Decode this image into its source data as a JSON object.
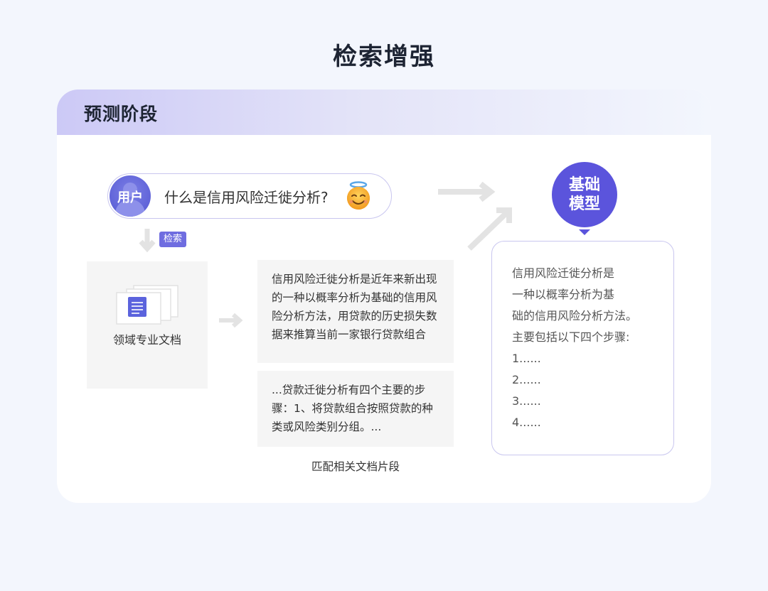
{
  "title": "检索增强",
  "stage": {
    "title": "预测阶段"
  },
  "query": {
    "avatar_label": "用户",
    "text": "什么是信用风险迁徙分析?"
  },
  "search_badge": "检索",
  "doc": {
    "label": "领域专业文档"
  },
  "snippets": [
    "信用风险迁徙分析是近年来新出现的一种以概率分析为基础的信用风险分析方法，用贷款的历史损失数据来推算当前一家银行贷款组合",
    "...贷款迁徙分析有四个主要的步骤：1、将贷款组合按照贷款的种类或风险类别分组。..."
  ],
  "snippet_caption": "匹配相关文档片段",
  "model": {
    "line1": "基础",
    "line2": "模型"
  },
  "answer": {
    "lines": [
      "信用风险迁徙分析是",
      "一种以概率分析为基",
      "础的信用风险分析方法。",
      "主要包括以下四个步骤:",
      "1......",
      "2......",
      "3......",
      "4......"
    ]
  },
  "colors": {
    "accent": "#5b54dc",
    "badge": "#6f6de0",
    "border": "#c9c6ef",
    "arrow": "#e3e3e3"
  }
}
